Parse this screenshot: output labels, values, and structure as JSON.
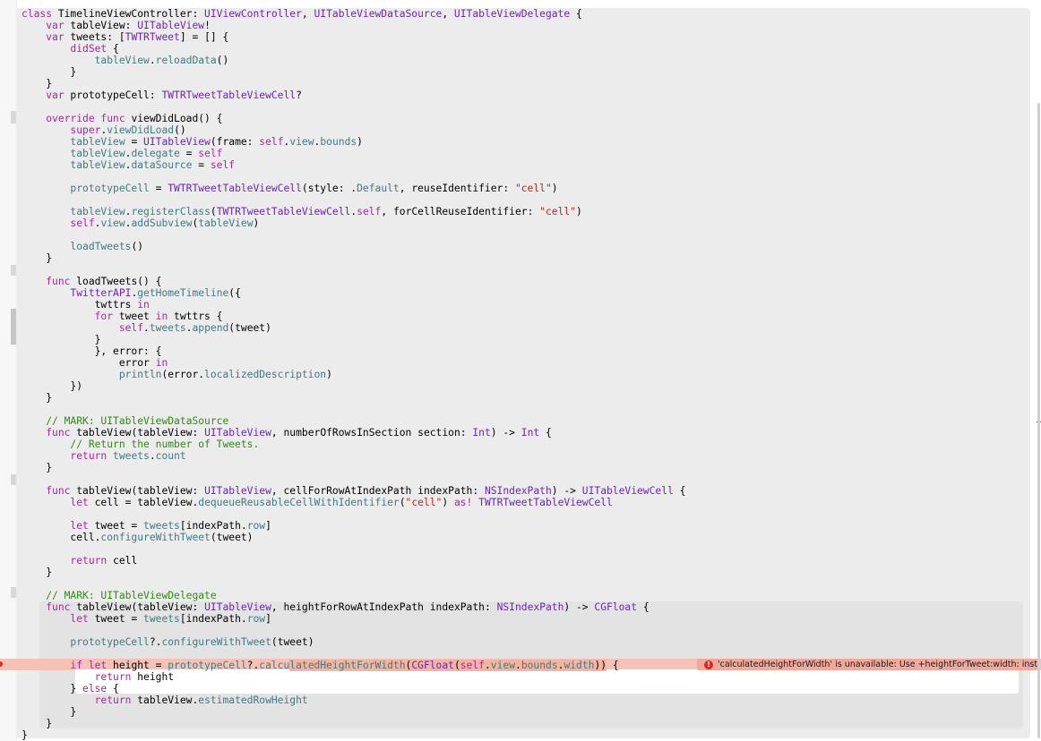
{
  "editor": {
    "language": "swift",
    "lines": [
      [
        {
          "t": "class ",
          "c": "kw"
        },
        {
          "t": "TimelineViewController: "
        },
        {
          "t": "UIViewController",
          "c": "ty"
        },
        {
          "t": ", "
        },
        {
          "t": "UITableViewDataSource",
          "c": "ty"
        },
        {
          "t": ", "
        },
        {
          "t": "UITableViewDelegate",
          "c": "ty"
        },
        {
          "t": " {"
        }
      ],
      [
        {
          "t": "    "
        },
        {
          "t": "var",
          "c": "kw"
        },
        {
          "t": " tableView: "
        },
        {
          "t": "UITableView",
          "c": "ty"
        },
        {
          "t": "!"
        }
      ],
      [
        {
          "t": "    "
        },
        {
          "t": "var",
          "c": "kw"
        },
        {
          "t": " tweets: ["
        },
        {
          "t": "TWTRTweet",
          "c": "ty"
        },
        {
          "t": "] = [] {"
        }
      ],
      [
        {
          "t": "        "
        },
        {
          "t": "didSet",
          "c": "kw"
        },
        {
          "t": " {"
        }
      ],
      [
        {
          "t": "            "
        },
        {
          "t": "tableView",
          "c": "pr"
        },
        {
          "t": "."
        },
        {
          "t": "reloadData",
          "c": "pr"
        },
        {
          "t": "()"
        }
      ],
      [
        {
          "t": "        }"
        }
      ],
      [
        {
          "t": "    }"
        }
      ],
      [
        {
          "t": "    "
        },
        {
          "t": "var",
          "c": "kw"
        },
        {
          "t": " prototypeCell: "
        },
        {
          "t": "TWTRTweetTableViewCell",
          "c": "ty"
        },
        {
          "t": "?"
        }
      ],
      [],
      [
        {
          "t": "    "
        },
        {
          "t": "override func",
          "c": "kw"
        },
        {
          "t": " viewDidLoad() {"
        }
      ],
      [
        {
          "t": "        "
        },
        {
          "t": "super",
          "c": "kw"
        },
        {
          "t": "."
        },
        {
          "t": "viewDidLoad",
          "c": "pr"
        },
        {
          "t": "()"
        }
      ],
      [
        {
          "t": "        "
        },
        {
          "t": "tableView",
          "c": "pr"
        },
        {
          "t": " = "
        },
        {
          "t": "UITableView",
          "c": "ty"
        },
        {
          "t": "(frame: "
        },
        {
          "t": "self",
          "c": "kw"
        },
        {
          "t": "."
        },
        {
          "t": "view",
          "c": "pr"
        },
        {
          "t": "."
        },
        {
          "t": "bounds",
          "c": "pr"
        },
        {
          "t": ")"
        }
      ],
      [
        {
          "t": "        "
        },
        {
          "t": "tableView",
          "c": "pr"
        },
        {
          "t": "."
        },
        {
          "t": "delegate",
          "c": "pr"
        },
        {
          "t": " = "
        },
        {
          "t": "self",
          "c": "kw"
        }
      ],
      [
        {
          "t": "        "
        },
        {
          "t": "tableView",
          "c": "pr"
        },
        {
          "t": "."
        },
        {
          "t": "dataSource",
          "c": "pr"
        },
        {
          "t": " = "
        },
        {
          "t": "self",
          "c": "kw"
        }
      ],
      [],
      [
        {
          "t": "        "
        },
        {
          "t": "prototypeCell",
          "c": "pr"
        },
        {
          "t": " = "
        },
        {
          "t": "TWTRTweetTableViewCell",
          "c": "ty"
        },
        {
          "t": "(style: ."
        },
        {
          "t": "Default",
          "c": "pr"
        },
        {
          "t": ", reuseIdentifier: "
        },
        {
          "t": "\"cell\"",
          "c": "st"
        },
        {
          "t": ")"
        }
      ],
      [],
      [
        {
          "t": "        "
        },
        {
          "t": "tableView",
          "c": "pr"
        },
        {
          "t": "."
        },
        {
          "t": "registerClass",
          "c": "pr"
        },
        {
          "t": "("
        },
        {
          "t": "TWTRTweetTableViewCell",
          "c": "ty"
        },
        {
          "t": "."
        },
        {
          "t": "self",
          "c": "kw"
        },
        {
          "t": ", forCellReuseIdentifier: "
        },
        {
          "t": "\"cell\"",
          "c": "st"
        },
        {
          "t": ")"
        }
      ],
      [
        {
          "t": "        "
        },
        {
          "t": "self",
          "c": "kw"
        },
        {
          "t": "."
        },
        {
          "t": "view",
          "c": "pr"
        },
        {
          "t": "."
        },
        {
          "t": "addSubview",
          "c": "pr"
        },
        {
          "t": "("
        },
        {
          "t": "tableView",
          "c": "pr"
        },
        {
          "t": ")"
        }
      ],
      [],
      [
        {
          "t": "        "
        },
        {
          "t": "loadTweets",
          "c": "pr"
        },
        {
          "t": "()"
        }
      ],
      [
        {
          "t": "    }"
        }
      ],
      [],
      [
        {
          "t": "    "
        },
        {
          "t": "func",
          "c": "kw"
        },
        {
          "t": " loadTweets() {"
        }
      ],
      [
        {
          "t": "        "
        },
        {
          "t": "TwitterAPI",
          "c": "ty"
        },
        {
          "t": "."
        },
        {
          "t": "getHomeTimeline",
          "c": "pr"
        },
        {
          "t": "({"
        }
      ],
      [
        {
          "t": "            twttrs "
        },
        {
          "t": "in",
          "c": "kw"
        }
      ],
      [
        {
          "t": "            "
        },
        {
          "t": "for",
          "c": "kw"
        },
        {
          "t": " tweet "
        },
        {
          "t": "in",
          "c": "kw"
        },
        {
          "t": " twttrs {"
        }
      ],
      [
        {
          "t": "                "
        },
        {
          "t": "self",
          "c": "kw"
        },
        {
          "t": "."
        },
        {
          "t": "tweets",
          "c": "pr"
        },
        {
          "t": "."
        },
        {
          "t": "append",
          "c": "pr"
        },
        {
          "t": "(tweet)"
        }
      ],
      [
        {
          "t": "            }"
        }
      ],
      [
        {
          "t": "            }, error: {"
        }
      ],
      [
        {
          "t": "                error "
        },
        {
          "t": "in",
          "c": "kw"
        }
      ],
      [
        {
          "t": "                "
        },
        {
          "t": "println",
          "c": "pr"
        },
        {
          "t": "(error."
        },
        {
          "t": "localizedDescription",
          "c": "pr"
        },
        {
          "t": ")"
        }
      ],
      [
        {
          "t": "        })"
        }
      ],
      [
        {
          "t": "    }"
        }
      ],
      [],
      [
        {
          "t": "    "
        },
        {
          "t": "// MARK: UITableViewDataSource",
          "c": "cm"
        }
      ],
      [
        {
          "t": "    "
        },
        {
          "t": "func",
          "c": "kw"
        },
        {
          "t": " tableView(tableView: "
        },
        {
          "t": "UITableView",
          "c": "ty"
        },
        {
          "t": ", numberOfRowsInSection section: "
        },
        {
          "t": "Int",
          "c": "ty"
        },
        {
          "t": ") -> "
        },
        {
          "t": "Int",
          "c": "ty"
        },
        {
          "t": " {"
        }
      ],
      [
        {
          "t": "        "
        },
        {
          "t": "// Return the number of Tweets.",
          "c": "cm"
        }
      ],
      [
        {
          "t": "        "
        },
        {
          "t": "return",
          "c": "kw"
        },
        {
          "t": " "
        },
        {
          "t": "tweets",
          "c": "pr"
        },
        {
          "t": "."
        },
        {
          "t": "count",
          "c": "pr"
        }
      ],
      [
        {
          "t": "    }"
        }
      ],
      [],
      [
        {
          "t": "    "
        },
        {
          "t": "func",
          "c": "kw"
        },
        {
          "t": " tableView(tableView: "
        },
        {
          "t": "UITableView",
          "c": "ty"
        },
        {
          "t": ", cellForRowAtIndexPath indexPath: "
        },
        {
          "t": "NSIndexPath",
          "c": "ty"
        },
        {
          "t": ") -> "
        },
        {
          "t": "UITableViewCell",
          "c": "ty"
        },
        {
          "t": " {"
        }
      ],
      [
        {
          "t": "        "
        },
        {
          "t": "let",
          "c": "kw"
        },
        {
          "t": " cell = tableView."
        },
        {
          "t": "dequeueReusableCellWithIdentifier",
          "c": "pr"
        },
        {
          "t": "("
        },
        {
          "t": "\"cell\"",
          "c": "st"
        },
        {
          "t": ") "
        },
        {
          "t": "as!",
          "c": "kw"
        },
        {
          "t": " "
        },
        {
          "t": "TWTRTweetTableViewCell",
          "c": "ty"
        }
      ],
      [],
      [
        {
          "t": "        "
        },
        {
          "t": "let",
          "c": "kw"
        },
        {
          "t": " tweet = "
        },
        {
          "t": "tweets",
          "c": "pr"
        },
        {
          "t": "[indexPath."
        },
        {
          "t": "row",
          "c": "pr"
        },
        {
          "t": "]"
        }
      ],
      [
        {
          "t": "        cell."
        },
        {
          "t": "configureWithTweet",
          "c": "pr"
        },
        {
          "t": "(tweet)"
        }
      ],
      [],
      [
        {
          "t": "        "
        },
        {
          "t": "return",
          "c": "kw"
        },
        {
          "t": " cell"
        }
      ],
      [
        {
          "t": "    }"
        }
      ],
      [],
      [
        {
          "t": "    "
        },
        {
          "t": "// MARK: UITableViewDelegate",
          "c": "cm"
        }
      ],
      [
        {
          "t": "    "
        },
        {
          "t": "func",
          "c": "kw"
        },
        {
          "t": " tableView(tableView: "
        },
        {
          "t": "UITableView",
          "c": "ty"
        },
        {
          "t": ", heightForRowAtIndexPath indexPath: "
        },
        {
          "t": "NSIndexPath",
          "c": "ty"
        },
        {
          "t": ") -> "
        },
        {
          "t": "CGFloat",
          "c": "ty"
        },
        {
          "t": " {"
        }
      ],
      [
        {
          "t": "        "
        },
        {
          "t": "let",
          "c": "kw"
        },
        {
          "t": " tweet = "
        },
        {
          "t": "tweets",
          "c": "pr"
        },
        {
          "t": "[indexPath."
        },
        {
          "t": "row",
          "c": "pr"
        },
        {
          "t": "]"
        }
      ],
      [],
      [
        {
          "t": "        "
        },
        {
          "t": "prototypeCell",
          "c": "pr"
        },
        {
          "t": "?."
        },
        {
          "t": "configureWithTweet",
          "c": "pr"
        },
        {
          "t": "(tweet)"
        }
      ],
      [],
      [
        {
          "t": "        "
        },
        {
          "t": "if let",
          "c": "kw"
        },
        {
          "t": " height = "
        },
        {
          "t": "prototypeCell",
          "c": "pr"
        },
        {
          "t": "?."
        },
        {
          "t": "calcu",
          "c": "pr"
        },
        {
          "t": "|",
          "c": "caret"
        },
        {
          "t": "latedHeightForWidth",
          "c": "pr hl"
        },
        {
          "t": "(",
          "c": "hl"
        },
        {
          "t": "CGFloat",
          "c": "ty hl"
        },
        {
          "t": "(",
          "c": "hl"
        },
        {
          "t": "self",
          "c": "kw hl"
        },
        {
          "t": ".",
          "c": "hl"
        },
        {
          "t": "view",
          "c": "pr hl"
        },
        {
          "t": ".",
          "c": "hl"
        },
        {
          "t": "bounds",
          "c": "pr hl"
        },
        {
          "t": ".",
          "c": "hl"
        },
        {
          "t": "width",
          "c": "pr hl"
        },
        {
          "t": "))",
          "c": "hl"
        },
        {
          "t": " {"
        }
      ],
      [
        {
          "t": "            "
        },
        {
          "t": "return",
          "c": "kw"
        },
        {
          "t": " height"
        }
      ],
      [
        {
          "t": "        } "
        },
        {
          "t": "else",
          "c": "kw"
        },
        {
          "t": " {"
        }
      ],
      [
        {
          "t": "            "
        },
        {
          "t": "return",
          "c": "kw"
        },
        {
          "t": " tableView."
        },
        {
          "t": "estimatedRowHeight",
          "c": "pr"
        }
      ],
      [
        {
          "t": "        }"
        }
      ],
      [
        {
          "t": "    }"
        }
      ],
      [
        {
          "t": "}"
        }
      ]
    ]
  },
  "issue": {
    "icon": "error-icon",
    "icon_glyph": "!",
    "message": "'calculatedHeightForWidth' is unavailable: Use +heightForTweet:width: instead."
  }
}
